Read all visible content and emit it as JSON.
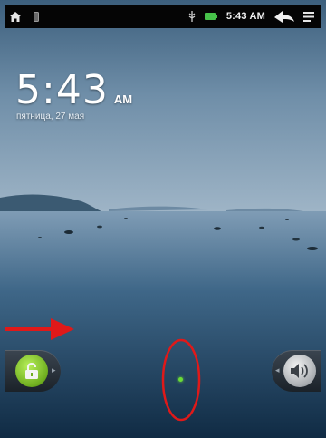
{
  "status_bar": {
    "time": "5:43 AM",
    "icons": [
      "home-icon",
      "device-icon",
      "usb-icon",
      "battery-icon",
      "back-icon",
      "menu-icon"
    ]
  },
  "lockscreen": {
    "clock_time": "5:43",
    "clock_ampm": "AM",
    "date": "пятница, 27 мая",
    "unlock_icon": "unlock-icon",
    "sound_icon": "sound-on-icon",
    "unlock_color": "#8fd12f",
    "indicator_color": "#6bdc36"
  },
  "annotations": {
    "color": "#e01919",
    "marks": [
      "arrow-right",
      "ellipse"
    ]
  }
}
